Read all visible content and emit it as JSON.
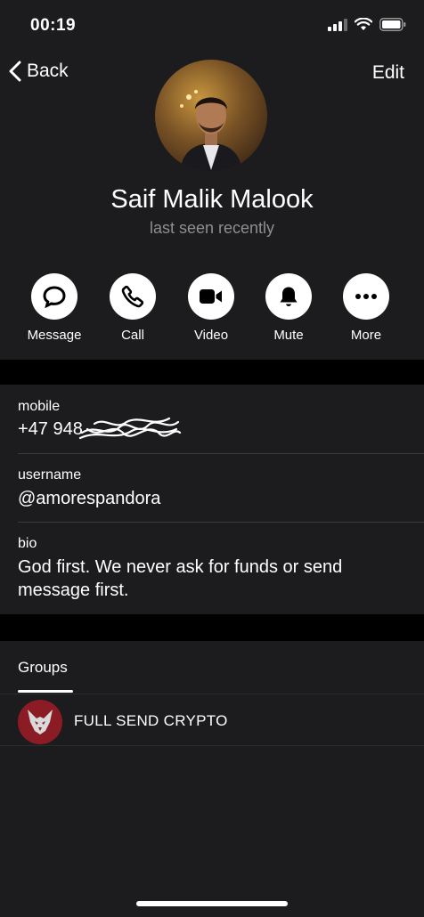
{
  "status_bar": {
    "time": "00:19"
  },
  "nav": {
    "back_label": "Back",
    "edit_label": "Edit"
  },
  "profile": {
    "name": "Saif Malik Malook",
    "status": "last seen recently"
  },
  "actions": [
    {
      "label": "Message",
      "icon": "message-icon"
    },
    {
      "label": "Call",
      "icon": "phone-icon"
    },
    {
      "label": "Video",
      "icon": "video-icon"
    },
    {
      "label": "Mute",
      "icon": "bell-icon"
    },
    {
      "label": "More",
      "icon": "more-icon"
    }
  ],
  "info": {
    "mobile_label": "mobile",
    "mobile_value": "+47 948",
    "username_label": "username",
    "username_value": "@amorespandora",
    "bio_label": "bio",
    "bio_line1": "God first. We never ask for funds or send",
    "bio_line2": "message first."
  },
  "groups": {
    "tab_label": "Groups",
    "items": [
      {
        "name": "FULL SEND CRYPTO"
      }
    ]
  },
  "colors": {
    "background": "#1c1c1e",
    "separator": "#000000",
    "secondary_text": "#8e8e93",
    "group_avatar": "#8b1c26"
  }
}
